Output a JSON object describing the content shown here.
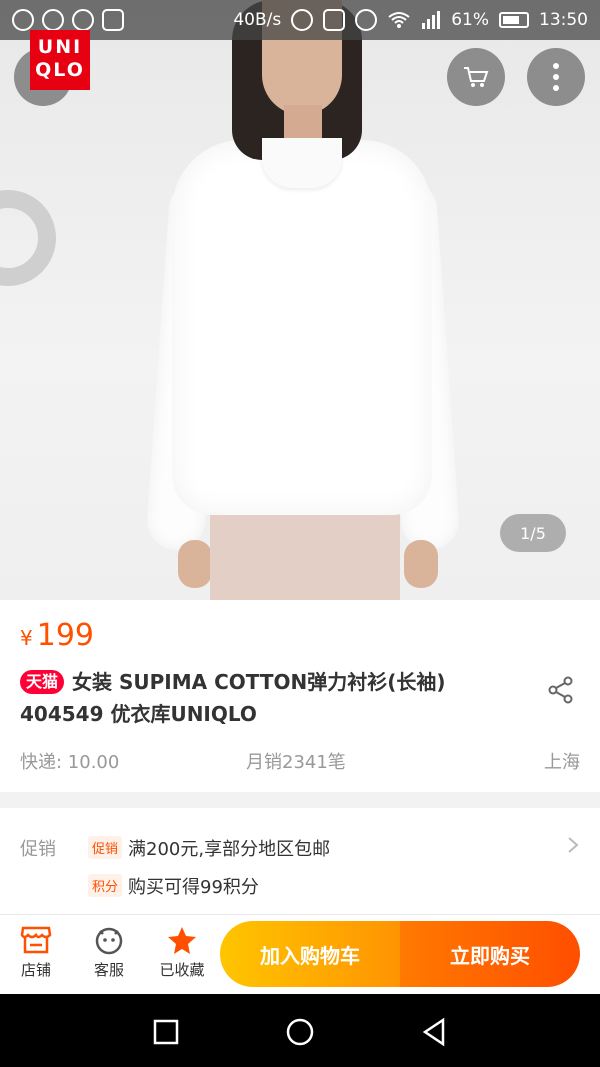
{
  "status_bar": {
    "net_speed": "40B/s",
    "battery": "61%",
    "battery_level": 0.61,
    "time": "13:50"
  },
  "hero": {
    "logo_line1": "UNI",
    "logo_line2": "QLO",
    "page_indicator": "1/5"
  },
  "product": {
    "currency": "¥",
    "price": "199",
    "store_badge": "天猫",
    "title": "女装 SUPIMA COTTON弹力衬衫(长袖) 404549 优衣库UNIQLO",
    "shipping": "快递: 10.00",
    "monthly_sales": "月销2341笔",
    "location": "上海"
  },
  "promo": {
    "label": "促销",
    "items": [
      {
        "tag": "促销",
        "text": "满200元,享部分地区包邮"
      },
      {
        "tag": "积分",
        "text": "购买可得99积分"
      }
    ]
  },
  "bottom_bar": {
    "store": "店铺",
    "service": "客服",
    "favorited": "已收藏",
    "add_to_cart": "加入购物车",
    "buy_now": "立即购买"
  },
  "colors": {
    "accent": "#ff5000",
    "tmall": "#ff0036",
    "cart_start": "#ffc500",
    "buy_end": "#ff4e00"
  }
}
